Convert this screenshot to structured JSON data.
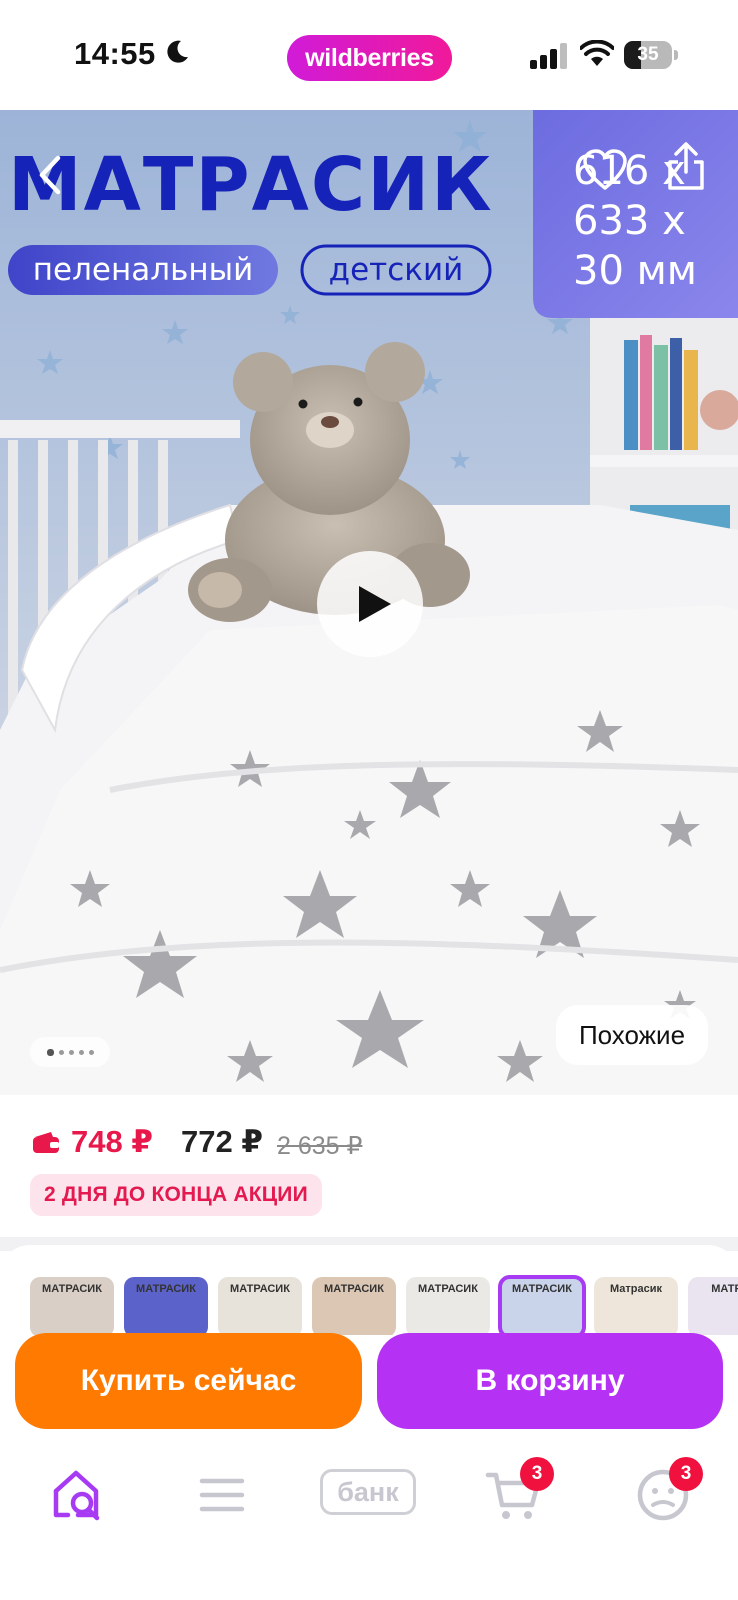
{
  "status_bar": {
    "time": "14:55",
    "app_pill": "wildberries",
    "battery_level": "35",
    "battery_fraction": 0.35
  },
  "product_image": {
    "banner_title": "МАТРАСИК",
    "tag_primary": "пеленальный",
    "tag_secondary": "детский",
    "size_line_1": "616 x",
    "size_line_2": "633 x",
    "size_line_3": "30 мм",
    "similar_label": "Похожие",
    "page_count": 5,
    "current_page": 1
  },
  "price": {
    "wallet_price": "748 ₽",
    "regular_price": "772 ₽",
    "old_price": "2 635 ₽",
    "promo_text": "2 ДНЯ ДО КОНЦА АКЦИИ"
  },
  "thumbnails": [
    {
      "label": "МАТРАСИК",
      "bg": "#d9cfc6"
    },
    {
      "label": "МАТРАСИК",
      "bg": "#5b62c9"
    },
    {
      "label": "МАТРАСИК",
      "bg": "#e7e2da"
    },
    {
      "label": "МАТРАСИК",
      "bg": "#dcc7b4"
    },
    {
      "label": "МАТРАСИК",
      "bg": "#ebe9e6"
    },
    {
      "label": "МАТРАСИК",
      "bg": "#c9d3ea",
      "selected": true
    },
    {
      "label": "Матрасик",
      "bg": "#efe6db"
    },
    {
      "label": "МАТРА",
      "bg": "#e9e4f0"
    }
  ],
  "actions": {
    "buy_now": "Купить сейчас",
    "add_to_cart": "В корзину"
  },
  "bottom_nav": {
    "bank_label": "банк",
    "cart_badge": "3",
    "profile_badge": "3"
  },
  "colors": {
    "brand_gradient_start": "#d01bd8",
    "brand_gradient_end": "#f0199a",
    "buy_button": "#ff7a00",
    "cart_button": "#b532f5",
    "price_accent": "#e8184b",
    "badge": "#f0113f"
  }
}
